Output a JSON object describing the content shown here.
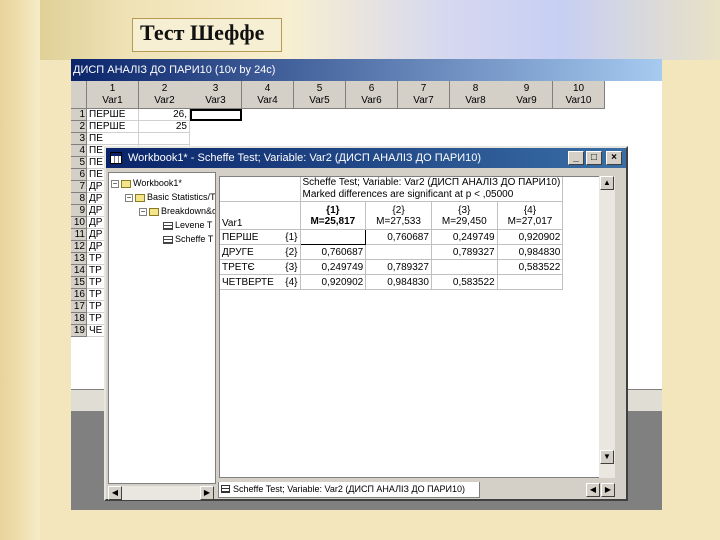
{
  "slide": {
    "title": "Тест Шеффе"
  },
  "background_window": {
    "title": "ДИСП АНАЛІЗ ДО ПАРИ10 (10v by 24c)",
    "columns": [
      {
        "num": "1",
        "name": "Var1"
      },
      {
        "num": "2",
        "name": "Var2"
      },
      {
        "num": "3",
        "name": "Var3"
      },
      {
        "num": "4",
        "name": "Var4"
      },
      {
        "num": "5",
        "name": "Var5"
      },
      {
        "num": "6",
        "name": "Var6"
      },
      {
        "num": "7",
        "name": "Var7"
      },
      {
        "num": "8",
        "name": "Var8"
      },
      {
        "num": "9",
        "name": "Var9"
      },
      {
        "num": "10",
        "name": "Var10"
      }
    ],
    "rows": [
      {
        "num": "1",
        "var1": "ПЕРШЕ",
        "var2": "26,"
      },
      {
        "num": "2",
        "var1": "ПЕРШЕ",
        "var2": "25"
      },
      {
        "num": "3",
        "var1": "ПЕ",
        "var2": ""
      },
      {
        "num": "4",
        "var1": "ПЕ",
        "var2": ""
      },
      {
        "num": "5",
        "var1": "ПЕ",
        "var2": ""
      },
      {
        "num": "6",
        "var1": "ПЕ",
        "var2": ""
      },
      {
        "num": "7",
        "var1": "ДР",
        "var2": ""
      },
      {
        "num": "8",
        "var1": "ДР",
        "var2": ""
      },
      {
        "num": "9",
        "var1": "ДР",
        "var2": ""
      },
      {
        "num": "10",
        "var1": "ДР",
        "var2": ""
      },
      {
        "num": "11",
        "var1": "ДР",
        "var2": ""
      },
      {
        "num": "12",
        "var1": "ДР",
        "var2": ""
      },
      {
        "num": "13",
        "var1": "ТР",
        "var2": ""
      },
      {
        "num": "14",
        "var1": "ТР",
        "var2": ""
      },
      {
        "num": "15",
        "var1": "ТР",
        "var2": ""
      },
      {
        "num": "16",
        "var1": "ТР",
        "var2": ""
      },
      {
        "num": "17",
        "var1": "ТР",
        "var2": ""
      },
      {
        "num": "18",
        "var1": "ТР",
        "var2": ""
      },
      {
        "num": "19",
        "var1": "ЧЕ",
        "var2": ""
      }
    ]
  },
  "workbook_window": {
    "title": "Workbook1* - Scheffe Test; Variable: Var2 (ДИСП АНАЛІЗ ДО ПАРИ10)",
    "buttons": {
      "minimize": "_",
      "maximize": "□",
      "close": "×"
    },
    "tree": [
      {
        "label": "Workbook1*",
        "level": 0,
        "icon": "book-icon",
        "expander": "−"
      },
      {
        "label": "Basic Statistics/Ta",
        "level": 1,
        "icon": "book-icon",
        "expander": "−"
      },
      {
        "label": "Breakdown&one",
        "level": 2,
        "icon": "book-icon",
        "expander": "−"
      },
      {
        "label": "Levene T",
        "level": 3,
        "icon": "sheet-icon",
        "expander": ""
      },
      {
        "label": "Scheffe T",
        "level": 3,
        "icon": "sheet-icon",
        "expander": ""
      }
    ],
    "result": {
      "header_line1": "Scheffe Test; Variable: Var2 (ДИСП АНАЛІЗ ДО ПАРИ10)",
      "header_line2": "Marked differences are significant at p < ,05000",
      "corner_label": "Var1",
      "columns": [
        {
          "num": "{1}",
          "mean": "M=25,817"
        },
        {
          "num": "{2}",
          "mean": "M=27,533"
        },
        {
          "num": "{3}",
          "mean": "M=29,450"
        },
        {
          "num": "{4}",
          "mean": "M=27,017"
        }
      ],
      "rows": [
        {
          "label": "ПЕРШЕ",
          "num": "{1}",
          "values": [
            "",
            "0,760687",
            "0,249749",
            "0,920902"
          ]
        },
        {
          "label": "ДРУГЕ",
          "num": "{2}",
          "values": [
            "0,760687",
            "",
            "0,789327",
            "0,984830"
          ]
        },
        {
          "label": "ТРЕТЄ",
          "num": "{3}",
          "values": [
            "0,249749",
            "0,789327",
            "",
            "0,583522"
          ]
        },
        {
          "label": "ЧЕТВЕРТЕ",
          "num": "{4}",
          "values": [
            "0,920902",
            "0,984830",
            "0,583522",
            ""
          ]
        }
      ]
    },
    "tab_label": "Scheffe Test; Variable: Var2 (ДИСП АНАЛІЗ ДО ПАРИ10)"
  }
}
